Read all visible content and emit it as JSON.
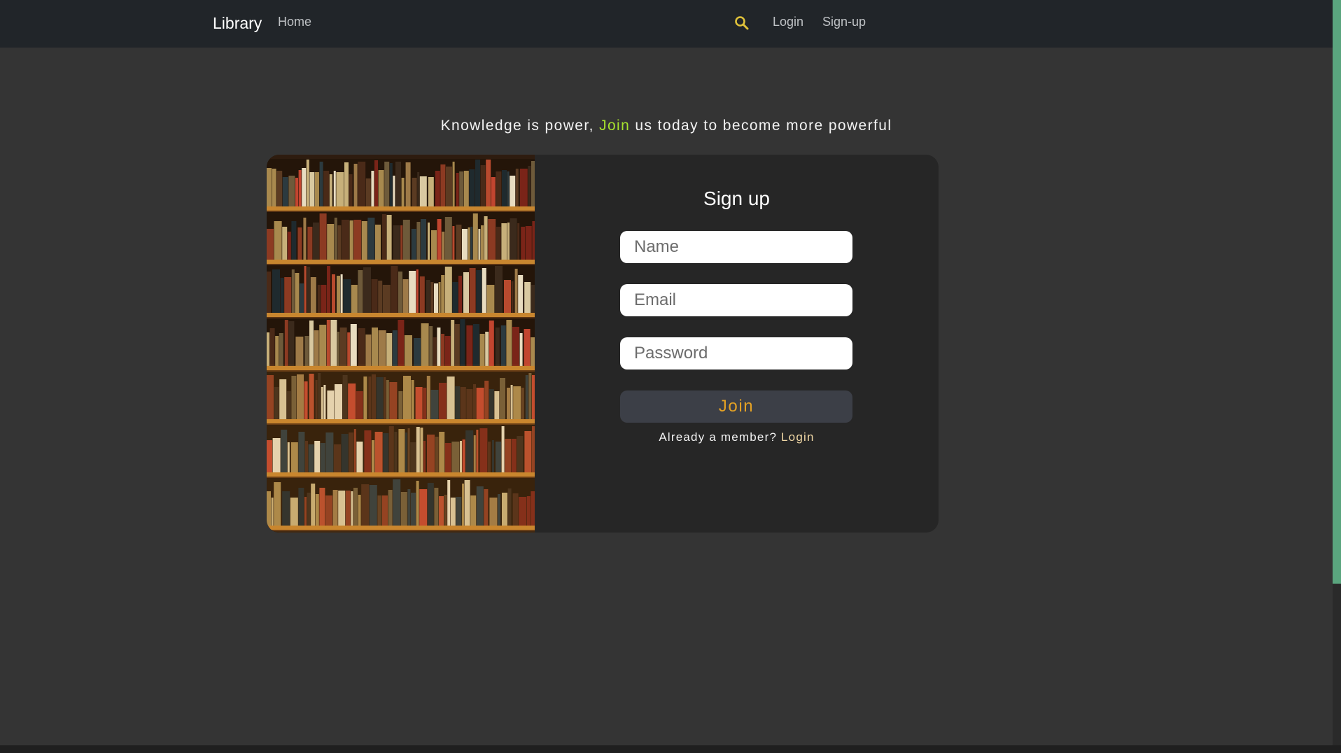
{
  "navbar": {
    "brand": "Library",
    "home": "Home",
    "login": "Login",
    "signup": "Sign-up",
    "search_icon": "search-icon",
    "search_icon_color": "#e0c23a"
  },
  "tagline": {
    "before": "Knowledge is power, ",
    "highlight": "Join",
    "after": " us today to become more powerful",
    "highlight_color": "#a6e22e"
  },
  "signup": {
    "title": "Sign up",
    "name_placeholder": "Name",
    "email_placeholder": "Email",
    "password_placeholder": "Password",
    "join_label": "Join",
    "member_prompt": "Already a member? ",
    "login_link": "Login"
  },
  "colors": {
    "page_background": "#343434",
    "navbar_background": "#212529",
    "card_background": "#262626",
    "join_button_background": "#3c3f47",
    "join_button_text": "#e5a224",
    "scrollbar_thumb": "#5aa57e"
  }
}
